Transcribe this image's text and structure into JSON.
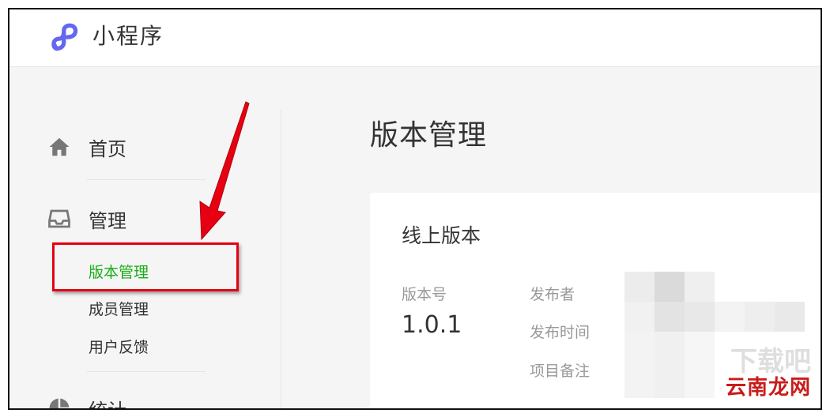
{
  "header": {
    "app_title": "小程序"
  },
  "sidebar": {
    "items": [
      {
        "label": "首页",
        "icon": "home-icon"
      },
      {
        "label": "管理",
        "icon": "inbox-icon"
      },
      {
        "label": "统计",
        "icon": "pie-chart-icon"
      }
    ],
    "sub_items": [
      {
        "label": "版本管理",
        "active": true
      },
      {
        "label": "成员管理"
      },
      {
        "label": "用户反馈"
      }
    ]
  },
  "main": {
    "page_title": "版本管理",
    "card": {
      "title": "线上版本",
      "version_label": "版本号",
      "version_value": "1.0.1",
      "fields": [
        "发布者",
        "发布时间",
        "项目备注"
      ]
    }
  },
  "watermark": {
    "text": "云南龙网"
  },
  "colors": {
    "active_green": "#1aad19",
    "highlight_red": "#e60012",
    "logo_purple": "#6467f0"
  }
}
